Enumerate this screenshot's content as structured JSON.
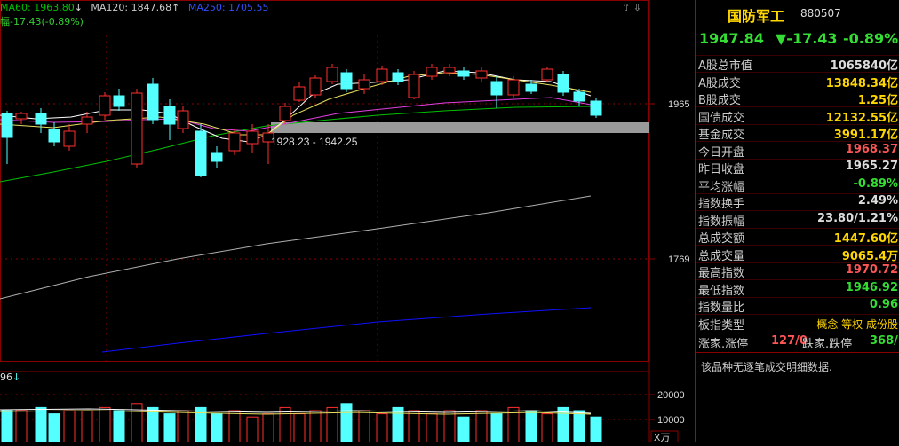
{
  "legend": {
    "ma60": "MA60: 1963.80",
    "ma60_arrow": "↓",
    "ma120": "MA120: 1847.68",
    "ma120_arrow": "↑",
    "ma250": "MA250: 1705.55",
    "change": "幅-17.43(-0.89%)",
    "volume_prefix": "96",
    "volume_arrow": "↓"
  },
  "price_axis": {
    "label_1965": "1965",
    "label_1769": "1769"
  },
  "volume_axis": {
    "label_20000": "20000",
    "label_10000": "10000",
    "unit": "X万"
  },
  "annotation": {
    "range_text": "1928.23 - 1942.25"
  },
  "header": {
    "name": "国防军工",
    "code": "880507",
    "price": "1947.84",
    "change": "▼-17.43",
    "change_pct": "-0.89%"
  },
  "stats": [
    {
      "label": "A股总市值",
      "value": "1065840亿",
      "color": "white"
    },
    {
      "label": "A股成交",
      "value": "13848.34亿",
      "color": "yellow"
    },
    {
      "label": "B股成交",
      "value": "1.25亿",
      "color": "yellow"
    },
    {
      "label": "国债成交",
      "value": "12132.55亿",
      "color": "yellow"
    },
    {
      "label": "基金成交",
      "value": "3991.17亿",
      "color": "yellow"
    },
    {
      "label": "今日开盘",
      "value": "1968.37",
      "color": "red"
    },
    {
      "label": "昨日收盘",
      "value": "1965.27",
      "color": "white"
    },
    {
      "label": "平均涨幅",
      "value": "-0.89%",
      "color": "green"
    },
    {
      "label": "指数换手",
      "value": "2.49%",
      "color": "white"
    },
    {
      "label": "指数振幅",
      "value": "23.80/1.21%",
      "color": "white"
    },
    {
      "label": "总成交额",
      "value": "1447.60亿",
      "color": "yellow"
    },
    {
      "label": "总成交量",
      "value": "9065.4万",
      "color": "yellow"
    },
    {
      "label": "最高指数",
      "value": "1970.72",
      "color": "red"
    },
    {
      "label": "最低指数",
      "value": "1946.92",
      "color": "green"
    },
    {
      "label": "指数量比",
      "value": "0.96",
      "color": "green"
    }
  ],
  "board": {
    "label": "板指类型",
    "value": "概念 等权 成份股"
  },
  "breadth": {
    "up_label": "涨家.涨停",
    "up_value": "127/0",
    "down_label": "跌家.跌停",
    "down_value": "368/1"
  },
  "note": "该品种无逐笔成交明细数据.",
  "colors": {
    "up": "#ff3030",
    "down": "#54ffff",
    "ma60": "#00c000",
    "ma120": "#b0b0b0",
    "ma250": "#1010ff",
    "grid": "#8a0000"
  }
}
